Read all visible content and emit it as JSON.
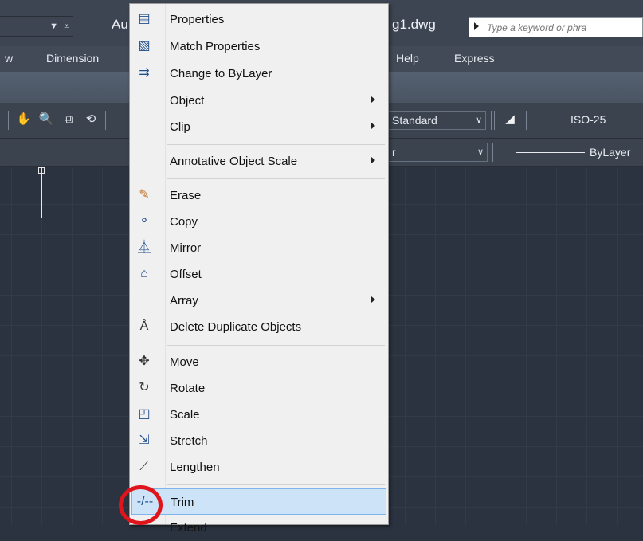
{
  "title_bar": {
    "title_left": "Au",
    "title_right": "g1.dwg",
    "search_placeholder": "Type a keyword or phra"
  },
  "menu_bar": {
    "items": [
      "w",
      "Dimension",
      "Help",
      "Express"
    ]
  },
  "toolbar": {
    "text_style": "Standard",
    "dim_style": "ISO-25",
    "layer_fragment": "r",
    "linetype": "ByLayer"
  },
  "context_menu": {
    "items": [
      {
        "label": "Properties",
        "icon": "properties-icon"
      },
      {
        "label": "Match Properties",
        "icon": "match-properties-icon"
      },
      {
        "label": "Change to ByLayer",
        "icon": "change-to-bylayer-icon"
      },
      {
        "label": "Object",
        "submenu": true
      },
      {
        "label": "Clip",
        "submenu": true
      },
      {
        "label": "Annotative Object Scale",
        "submenu": true
      },
      {
        "label": "Erase",
        "icon": "erase-icon"
      },
      {
        "label": "Copy",
        "icon": "copy-icon"
      },
      {
        "label": "Mirror",
        "icon": "mirror-icon"
      },
      {
        "label": "Offset",
        "icon": "offset-icon"
      },
      {
        "label": "Array",
        "submenu": true
      },
      {
        "label": "Delete Duplicate Objects",
        "icon": "delete-duplicates-icon"
      },
      {
        "label": "Move",
        "icon": "move-icon"
      },
      {
        "label": "Rotate",
        "icon": "rotate-icon"
      },
      {
        "label": "Scale",
        "icon": "scale-icon"
      },
      {
        "label": "Stretch",
        "icon": "stretch-icon"
      },
      {
        "label": "Lengthen",
        "icon": "lengthen-icon"
      },
      {
        "label": "Trim",
        "icon": "trim-icon",
        "highlighted": true
      },
      {
        "label": "Extend",
        "icon": "extend-icon"
      }
    ]
  },
  "colors": {
    "highlight": "#cde3f7",
    "annotation_ring": "#e0141b",
    "canvas": "#2b3340"
  }
}
